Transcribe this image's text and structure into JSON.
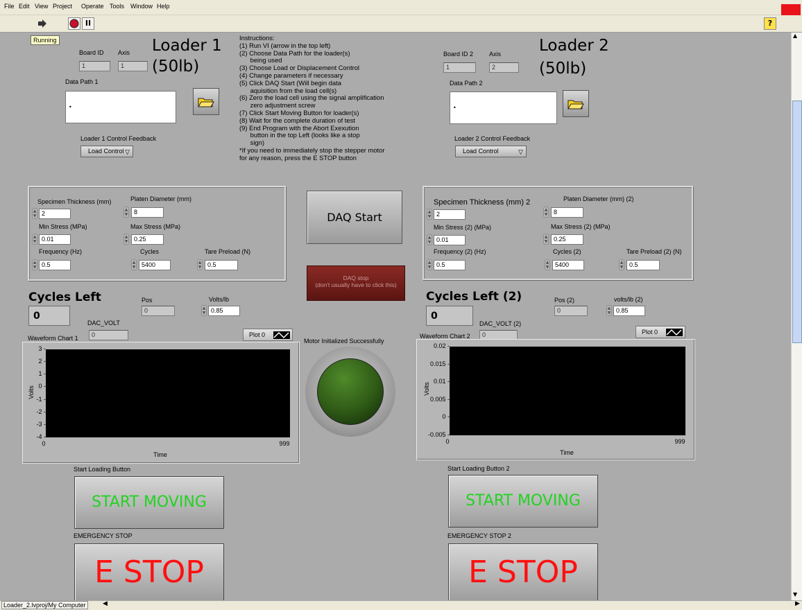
{
  "menu": [
    "File",
    "Edit",
    "View",
    "Project",
    "Operate",
    "Tools",
    "Window",
    "Help"
  ],
  "toolbar": {
    "run_icon": "run-arrow-icon",
    "abort_icon": "abort-stop-icon",
    "pause_label": "II",
    "help_label": "?"
  },
  "status": {
    "running": "Running"
  },
  "instructions": [
    "Instructions:",
    "(1) Run VI (arrow in the top left)",
    "(2) Choose Data Path for the loader(s)",
    "      being used",
    "(3) Choose Load or Displacement Control",
    "(4) Change parameters if necessary",
    "(5) Click DAQ Start (Will begin data",
    "      aquisition from the load cell(s)",
    "(6) Zero the load cell using the signal amplification",
    "      zero adjustment screw",
    "(7) Click Start Moving Button for loader(s)",
    "(8) Wait for the complete duration of test",
    "(9) End Program with the Abort Exexution",
    "      button in the top Left (looks like a stop",
    "      sign)",
    "*If you need to immediately stop the stepper motor",
    "for any reason, press the E STOP button"
  ],
  "loader1": {
    "title1": "Loader 1",
    "title2": "(50lb)",
    "board_id_label": "Board ID",
    "board_id": "1",
    "axis_label": "Axis",
    "axis": "1",
    "data_path_label": "Data Path 1",
    "feedback_label": "Loader 1 Control Feedback",
    "feedback_value": "Load Control",
    "thickness_label": "Specimen Thickness (mm)",
    "thickness": "2",
    "platen_label": "Platen Diameter (mm)",
    "platen": "8",
    "min_stress_label": "Min Stress (MPa)",
    "min_stress": "0.01",
    "max_stress_label": "Max Stress (MPa)",
    "max_stress": "0.25",
    "freq_label": "Frequency (Hz)",
    "freq": "0.5",
    "cycles_label": "Cycles",
    "cycles": "5400",
    "tare_label": "Tare Preload (N)",
    "tare": "0.5",
    "cycles_left_label": "Cycles Left",
    "cycles_left": "0",
    "pos_label": "Pos",
    "pos": "0",
    "volts_label": "Volts/lb",
    "volts": "0.85",
    "dac_label": "DAC_VOLT",
    "dac": "0",
    "chart_label": "Waveform Chart 1",
    "plot_legend": "Plot 0",
    "start_label": "Start Loading Button",
    "start_text": "START MOVING",
    "estop_label": "EMERGENCY STOP",
    "estop_text": "E STOP"
  },
  "loader2": {
    "title1": "Loader 2",
    "title2": "(50lb)",
    "board_id_label": "Board ID 2",
    "board_id": "1",
    "axis_label": "Axis",
    "axis": "2",
    "data_path_label": "Data Path 2",
    "feedback_label": "Loader 2 Control Feedback",
    "feedback_value": "Load Control",
    "thickness_label": "Specimen Thickness (mm) 2",
    "thickness": "2",
    "platen_label": "Platen Diameter (mm) (2)",
    "platen": "8",
    "min_stress_label": "Min Stress (2) (MPa)",
    "min_stress": "0.01",
    "max_stress_label": "Max Stress (2) (MPa)",
    "max_stress": "0.25",
    "freq_label": "Frequency (2) (Hz)",
    "freq": "0.5",
    "cycles_label": "Cycles (2)",
    "cycles": "5400",
    "tare_label": "Tare Preload (2) (N)",
    "tare": "0.5",
    "cycles_left_label": "Cycles Left (2)",
    "cycles_left": "0",
    "pos_label": "Pos (2)",
    "pos": "0",
    "volts_label": "volts/lb (2)",
    "volts": "0.85",
    "dac_label": "DAC_VOLT (2)",
    "dac": "0",
    "chart_label": "Waveform Chart 2",
    "plot_legend": "Plot 0",
    "start_label": "Start Loading Button 2",
    "start_text": "START MOVING",
    "estop_label": "EMERGENCY STOP 2",
    "estop_text": "E STOP"
  },
  "daq": {
    "start": "DAQ Start",
    "stop_line1": "DAQ stop",
    "stop_line2": "(don't usually have to click this)"
  },
  "motor": {
    "label": "Motor Initialized Successfully",
    "led_color": "#2f5a16"
  },
  "statusbar": {
    "project": "Loader_2.lvproj/My Computer"
  },
  "colors": {
    "panel": "#ababab",
    "start_text": "#21d321",
    "estop_text": "#ff1010",
    "daq_stop": "#6e1b17"
  },
  "chart_data": [
    {
      "type": "line",
      "title": "Waveform Chart 1",
      "xlabel": "Time",
      "ylabel": "Volts",
      "xlim": [
        0,
        999
      ],
      "ylim": [
        -4,
        3
      ],
      "yticks": [
        "3",
        "2",
        "1",
        "0",
        "-1",
        "-2",
        "-3",
        "-4"
      ],
      "xticks": [
        "0",
        "999"
      ],
      "series": [
        {
          "name": "Plot 0",
          "values": []
        }
      ]
    },
    {
      "type": "line",
      "title": "Waveform Chart 2",
      "xlabel": "Time",
      "ylabel": "Volts",
      "xlim": [
        0,
        999
      ],
      "ylim": [
        -0.005,
        0.02
      ],
      "yticks": [
        "0.02",
        "0.015",
        "0.01",
        "0.005",
        "0",
        "-0.005"
      ],
      "xticks": [
        "0",
        "999"
      ],
      "series": [
        {
          "name": "Plot 0",
          "values": []
        }
      ]
    }
  ]
}
